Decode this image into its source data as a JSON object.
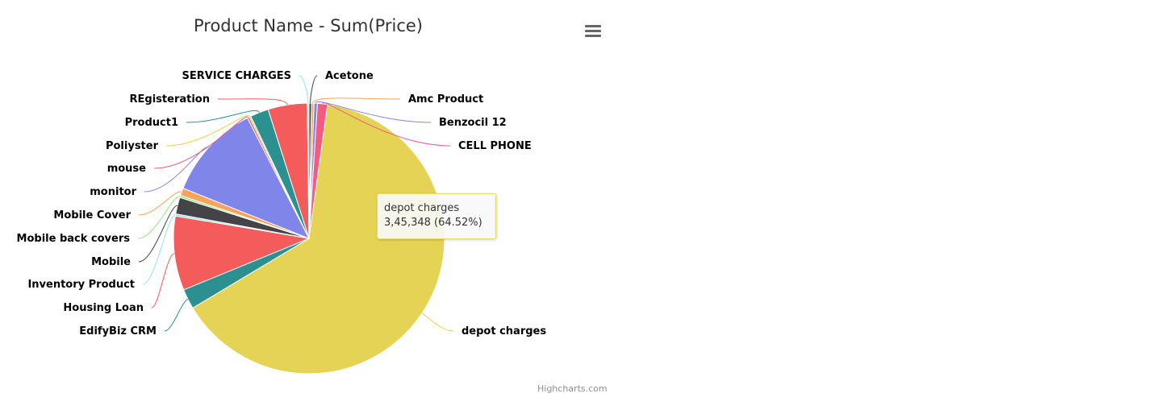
{
  "title": "Product Name - Sum(Price)",
  "credits": "Highcharts.com",
  "menu_icon": "hamburger-menu-icon",
  "tooltip": {
    "name": "depot charges",
    "value_text": "3,45,348 (64.52%)"
  },
  "chart_data": {
    "type": "pie",
    "title": "Product Name - Sum(Price)",
    "legend": "none",
    "slices": [
      {
        "name": "Acetone",
        "value": 0.3,
        "color": "#434348"
      },
      {
        "name": "Amc Product",
        "value": 0.3,
        "color": "#f7a35c"
      },
      {
        "name": "Benzocil 12",
        "value": 0.4,
        "color": "#8085e9"
      },
      {
        "name": "CELL PHONE",
        "value": 1.2,
        "color": "#f15c80"
      },
      {
        "name": "depot charges",
        "value": 64.52,
        "color": "#e4d354"
      },
      {
        "name": "EdifyBiz CRM",
        "value": 2.4,
        "color": "#2b908f"
      },
      {
        "name": "Housing Loan",
        "value": 8.9,
        "color": "#f45b5b"
      },
      {
        "name": "Inventory Product",
        "value": 0.25,
        "color": "#91e8e1"
      },
      {
        "name": "Mobile",
        "value": 2.0,
        "color": "#434348"
      },
      {
        "name": "Mobile back covers",
        "value": 0.25,
        "color": "#90ed7d"
      },
      {
        "name": "Mobile Cover",
        "value": 0.9,
        "color": "#f7a35c"
      },
      {
        "name": "monitor",
        "value": 11.5,
        "color": "#8085e9"
      },
      {
        "name": "mouse",
        "value": 0.25,
        "color": "#f15c80"
      },
      {
        "name": "Poliyster",
        "value": 0.2,
        "color": "#e4d354"
      },
      {
        "name": "Product1",
        "value": 2.2,
        "color": "#2b908f"
      },
      {
        "name": "REgisteration",
        "value": 4.7,
        "color": "#f45b5b"
      },
      {
        "name": "SERVICE CHARGES",
        "value": 0.2,
        "color": "#91e8e1"
      }
    ]
  }
}
